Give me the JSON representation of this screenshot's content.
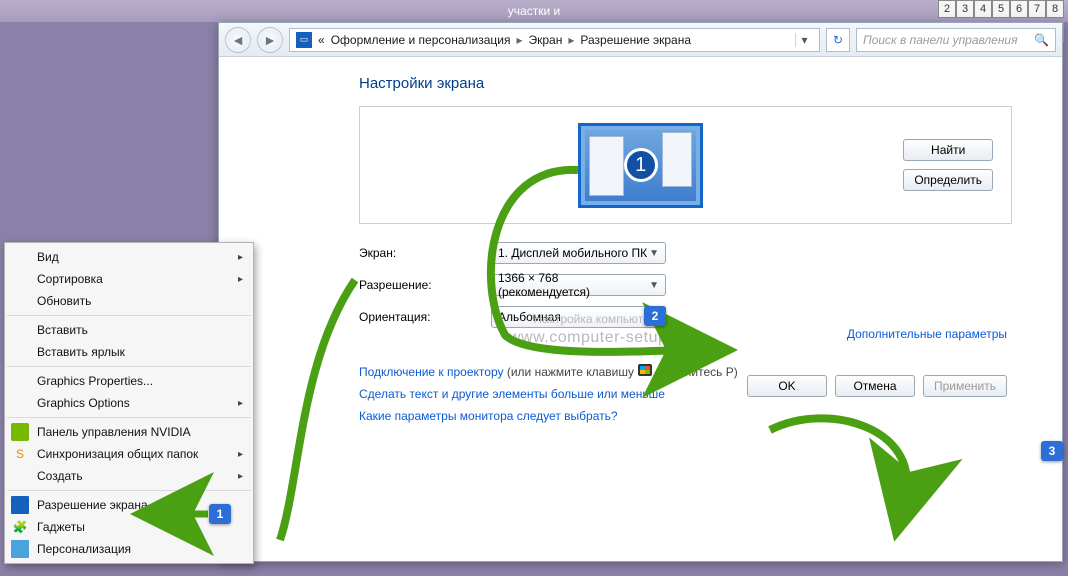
{
  "taskbar_title": "участки и",
  "top_numbers": [
    "2",
    "3",
    "4",
    "5",
    "6",
    "7",
    "8"
  ],
  "window_controls": {
    "min": "—",
    "max": "□",
    "close": "✕"
  },
  "addressbar": {
    "prefix": "«",
    "crumb1": "Оформление и персонализация",
    "crumb2": "Экран",
    "crumb3": "Разрешение экрана"
  },
  "search": {
    "placeholder": "Поиск в панели управления"
  },
  "heading": "Настройки экрана",
  "preview": {
    "monitor_number": "1",
    "find": "Найти",
    "detect": "Определить"
  },
  "form": {
    "display_label": "Экран:",
    "display_value": "1. Дисплей мобильного ПК",
    "resolution_label": "Разрешение:",
    "resolution_value": "1366 × 768 (рекомендуется)",
    "orientation_label": "Ориентация:",
    "orientation_value": "Альбомная"
  },
  "watermark": {
    "line1": "Настройка компьютера",
    "line2": "www.computer-setup.ru"
  },
  "advanced_link": "Дополнительные параметры",
  "links": {
    "projector_link": "Подключение к проектору",
    "projector_after": " (или нажмите клавишу ",
    "projector_after2": " и коснитесь Р)",
    "text_bigger": "Сделать текст и другие элементы больше или меньше",
    "monitor_q": "Какие параметры монитора следует выбрать?"
  },
  "dlg": {
    "ok": "OK",
    "cancel": "Отмена",
    "apply": "Применить"
  },
  "ctx": {
    "view": "Вид",
    "sort": "Сортировка",
    "refresh": "Обновить",
    "paste": "Вставить",
    "paste_shortcut": "Вставить ярлык",
    "gp": "Graphics Properties...",
    "go": "Graphics Options",
    "nvidia": "Панель управления NVIDIA",
    "sync": "Синхронизация общих папок",
    "create": "Создать",
    "resolution": "Разрешение экрана",
    "gadgets": "Гаджеты",
    "personalize": "Персонализация"
  },
  "callouts": {
    "c1": "1",
    "c2": "2",
    "c3": "3"
  }
}
